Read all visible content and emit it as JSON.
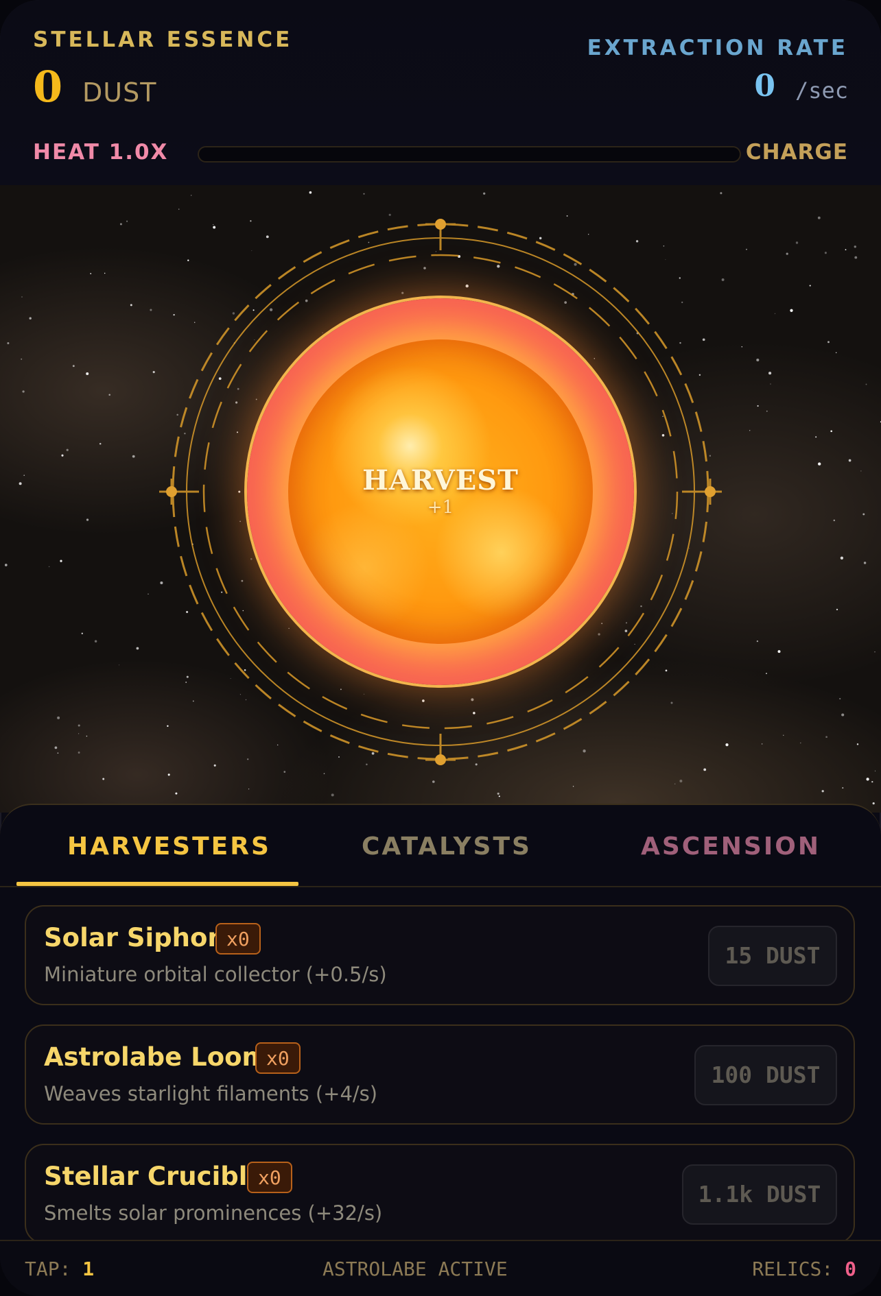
{
  "header": {
    "essence_label": "STELLAR ESSENCE",
    "essence_value": "0",
    "essence_unit": "DUST",
    "rate_label": "EXTRACTION RATE",
    "rate_value": "0",
    "rate_unit": "/sec",
    "heat_label": "HEAT 1.0X",
    "heat_charge_percent": 0,
    "charge_label": "CHARGE"
  },
  "orb": {
    "label": "HARVEST",
    "gain": "+1"
  },
  "tabs": [
    {
      "label": "HARVESTERS",
      "active": true
    },
    {
      "label": "CATALYSTS",
      "active": false
    },
    {
      "label": "ASCENSION",
      "active": false
    }
  ],
  "items": [
    {
      "name": "Solar Siphon",
      "count": "x0",
      "desc": "Miniature orbital collector (+0.5/s)",
      "cost": "15 DUST"
    },
    {
      "name": "Astrolabe Loom",
      "count": "x0",
      "desc": "Weaves starlight filaments (+4/s)",
      "cost": "100 DUST"
    },
    {
      "name": "Stellar Crucible",
      "count": "x0",
      "desc": "Smelts solar prominences (+32/s)",
      "cost": "1.1k DUST"
    }
  ],
  "footer": {
    "tap_label": "TAP:",
    "tap_value": "1",
    "status": "ASTROLABE ACTIVE",
    "relics_label": "RELICS:",
    "relics_value": "0"
  },
  "colors": {
    "gold": "#f5c542",
    "rate_blue": "#79c3f0",
    "heat_pink": "#f08aa8",
    "ascension": "#a0607a"
  }
}
